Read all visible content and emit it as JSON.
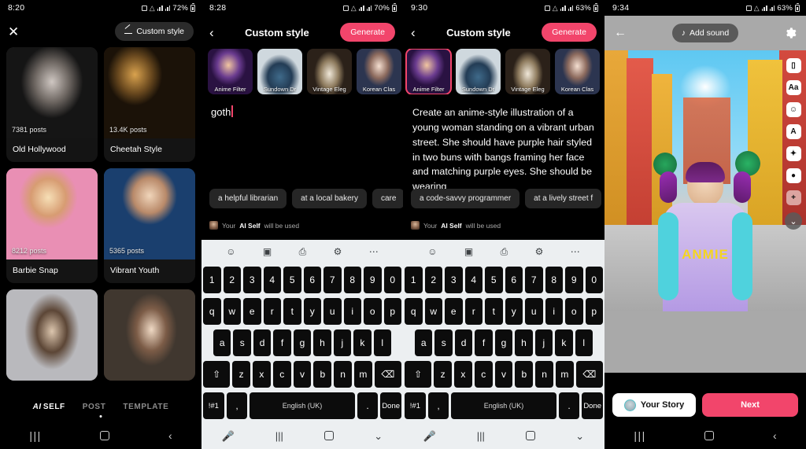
{
  "panel1": {
    "status": {
      "time": "8:20",
      "battery": "72%"
    },
    "close_label": "✕",
    "custom_style_pill": "Custom style",
    "cards": [
      {
        "posts": "7381 posts",
        "name": "Old Hollywood"
      },
      {
        "posts": "13.4K posts",
        "name": "Cheetah Style"
      },
      {
        "posts": "8212 posts",
        "name": "Barbie Snap"
      },
      {
        "posts": "5365 posts",
        "name": "Vibrant Youth"
      },
      {
        "posts": "",
        "name": ""
      },
      {
        "posts": "",
        "name": ""
      }
    ],
    "tabs": [
      {
        "prefix": "AI",
        "label": "SELF",
        "active": true
      },
      {
        "prefix": "",
        "label": "POST",
        "active": false
      },
      {
        "prefix": "",
        "label": "TEMPLATE",
        "active": false
      }
    ]
  },
  "panel2": {
    "status": {
      "time": "8:28",
      "battery": "70%"
    },
    "header": {
      "back": "‹",
      "title": "Custom style",
      "generate": "Generate"
    },
    "styles": [
      {
        "label": "Anime Filter",
        "selected": false
      },
      {
        "label": "Sundown Dr",
        "selected": false
      },
      {
        "label": "Vintage Eleg",
        "selected": false
      },
      {
        "label": "Korean Clas",
        "selected": false
      },
      {
        "label": "",
        "selected": false
      }
    ],
    "prompt_value": "goth",
    "chips": [
      "a helpful librarian",
      "at a local bakery",
      "care"
    ],
    "aiself_prefix": "Your ",
    "aiself_bold": "AI Self",
    "aiself_suffix": " will be used"
  },
  "panel3": {
    "status": {
      "time": "9:30",
      "battery": "63%"
    },
    "header": {
      "back": "‹",
      "title": "Custom style",
      "generate": "Generate"
    },
    "styles": [
      {
        "label": "Anime Filter",
        "selected": true
      },
      {
        "label": "Sundown Dr",
        "selected": false
      },
      {
        "label": "Vintage Eleg",
        "selected": false
      },
      {
        "label": "Korean Clas",
        "selected": false
      },
      {
        "label": "",
        "selected": false
      }
    ],
    "prompt_value": "Create an anime-style illustration of a young woman standing on a vibrant urban street. She should have purple hair styled in two buns with bangs framing her face and matching purple eyes. She should be wearing",
    "chips": [
      "a code-savvy programmer",
      "at a lively street f"
    ],
    "aiself_prefix": "Your ",
    "aiself_bold": "AI Self",
    "aiself_suffix": " will be used"
  },
  "panel4": {
    "status": {
      "time": "9:34",
      "battery": "63%"
    },
    "add_sound": "Add sound",
    "sweatshirt_text": "ANMIE",
    "tools": [
      "crop-icon",
      "text-aa-icon",
      "sticker-icon",
      "text-effect-icon",
      "sparkle-effects-icon",
      "layers-icon",
      "add-icon"
    ],
    "your_story": "Your Story",
    "next": "Next"
  },
  "keyboard": {
    "toolbar_icons": [
      "emoji-icon",
      "gif-sticker-icon",
      "clipboard-icon",
      "settings-icon",
      "more-icon"
    ],
    "row_numbers": [
      "1",
      "2",
      "3",
      "4",
      "5",
      "6",
      "7",
      "8",
      "9",
      "0"
    ],
    "row_top": [
      "q",
      "w",
      "e",
      "r",
      "t",
      "y",
      "u",
      "i",
      "o",
      "p"
    ],
    "row_mid": [
      "a",
      "s",
      "d",
      "f",
      "g",
      "h",
      "j",
      "k",
      "l"
    ],
    "row_bot": [
      "z",
      "x",
      "c",
      "v",
      "b",
      "n",
      "m"
    ],
    "shift": "⇧",
    "backspace": "⌫",
    "symbols": "!#1",
    "comma": ",",
    "space_label": "English (UK)",
    "period": ".",
    "done": "Done"
  },
  "colors": {
    "accent_pink": "#f2456b",
    "key_black": "#0c0c0c",
    "kb_bg": "#eceff1"
  }
}
